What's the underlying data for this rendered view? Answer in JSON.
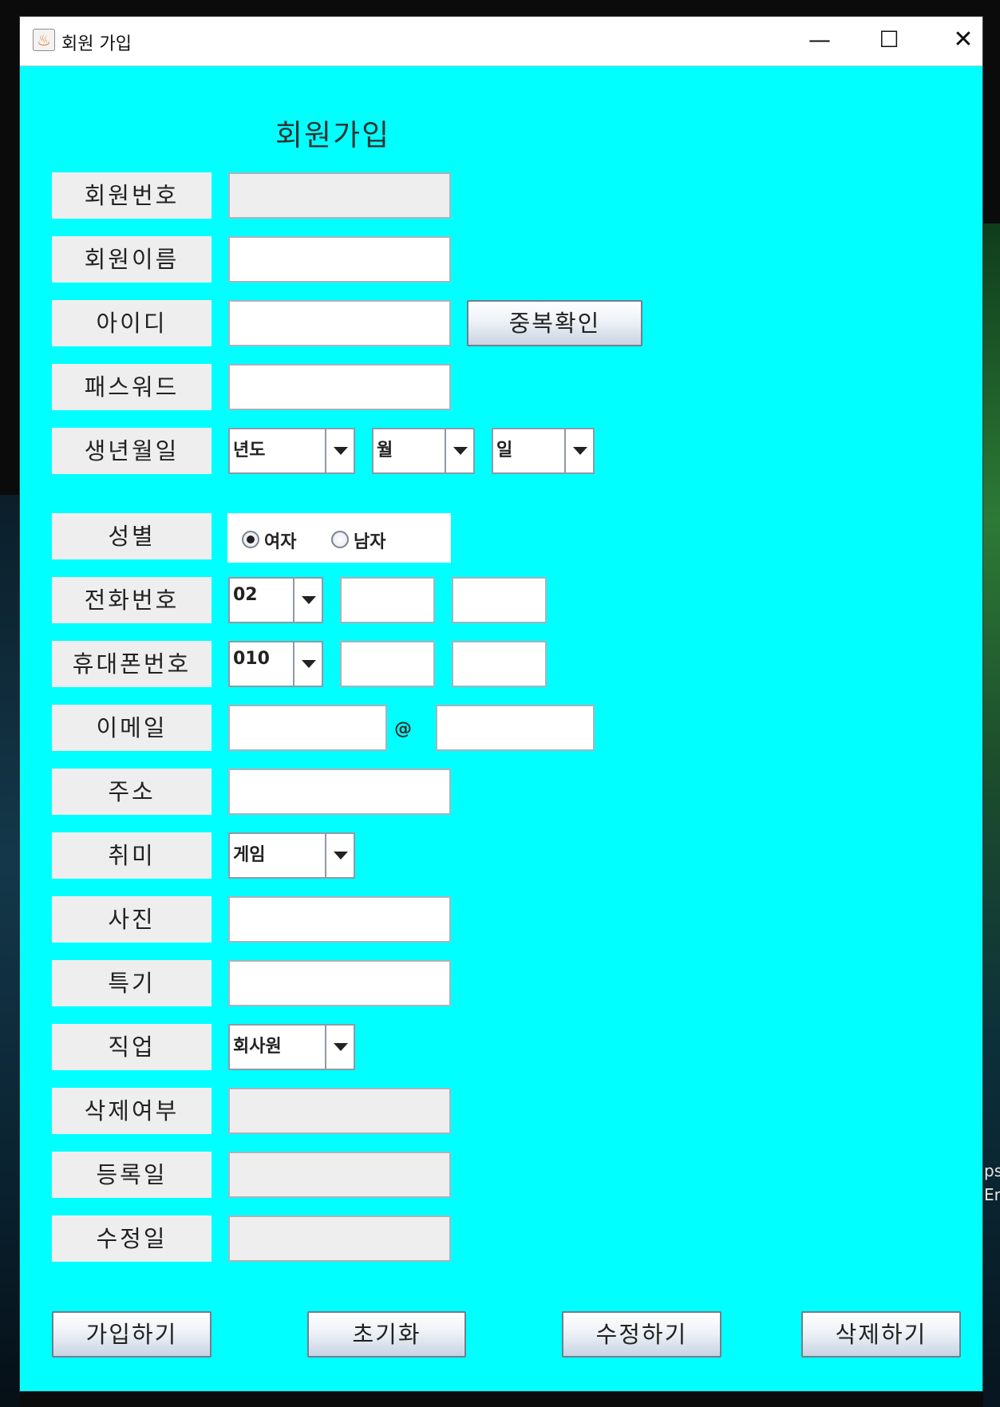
{
  "window": {
    "title": "회원 가입",
    "minimize_glyph": "—",
    "maximize_glyph": "☐",
    "close_glyph": "✕"
  },
  "form": {
    "heading": "회원가입",
    "labels": {
      "member_no": "회원번호",
      "member_name": "회원이름",
      "user_id": "아이디",
      "password": "패스워드",
      "birth": "생년월일",
      "gender": "성별",
      "phone": "전화번호",
      "mobile": "휴대폰번호",
      "email": "이메일",
      "address": "주소",
      "hobby": "취미",
      "photo": "사진",
      "talent": "특기",
      "job": "직업",
      "deleted": "삭제여부",
      "reg_date": "등록일",
      "mod_date": "수정일"
    },
    "values": {
      "member_no": "",
      "member_name": "",
      "user_id": "",
      "password": "",
      "phone_mid": "",
      "phone_last": "",
      "mobile_mid": "",
      "mobile_last": "",
      "email_user": "",
      "email_domain": "",
      "address": "",
      "photo": "",
      "talent": "",
      "deleted": "",
      "reg_date": "",
      "mod_date": ""
    },
    "combos": {
      "birth_year": "년도",
      "birth_month": "월",
      "birth_day": "일",
      "phone_area": "02",
      "mobile_prefix": "010",
      "hobby": "게임",
      "job": "회사원"
    },
    "gender_options": [
      "여자",
      "남자"
    ],
    "gender_selected": "여자",
    "email_at": "@",
    "dup_check_button": "중복확인",
    "buttons": {
      "join": "가입하기",
      "reset": "초기화",
      "edit": "수정하기",
      "delete": "삭제하기"
    }
  },
  "desktop": {
    "text_fragment_1": "ps",
    "text_fragment_2": "Em"
  }
}
